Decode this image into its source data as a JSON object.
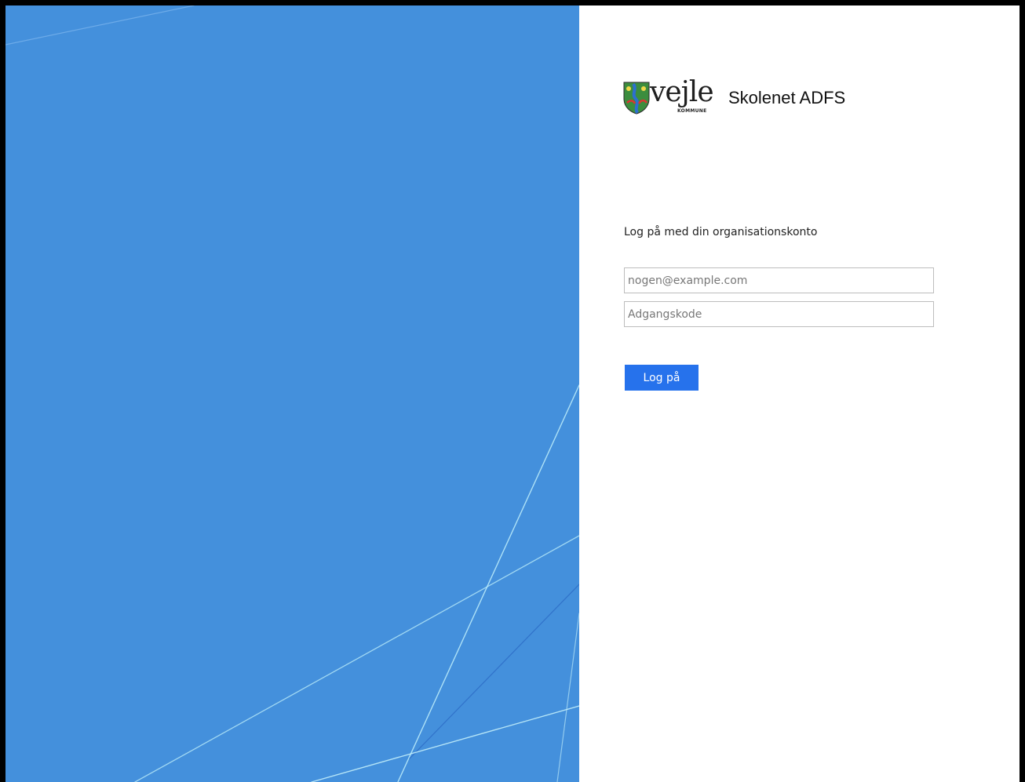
{
  "brand": {
    "logo_word": "vejle",
    "logo_sub": "KOMMUNE",
    "app_title": "Skolenet ADFS"
  },
  "login": {
    "prompt": "Log på med din organisationskonto",
    "email_placeholder": "nogen@example.com",
    "email_value": "",
    "password_placeholder": "Adgangskode",
    "password_value": "",
    "submit_label": "Log på"
  },
  "colors": {
    "left_panel": "#4490dc",
    "button": "#2672ec",
    "lines": "#a8e6f6"
  },
  "icons": {
    "logo": "vejle-coat-of-arms-icon"
  }
}
